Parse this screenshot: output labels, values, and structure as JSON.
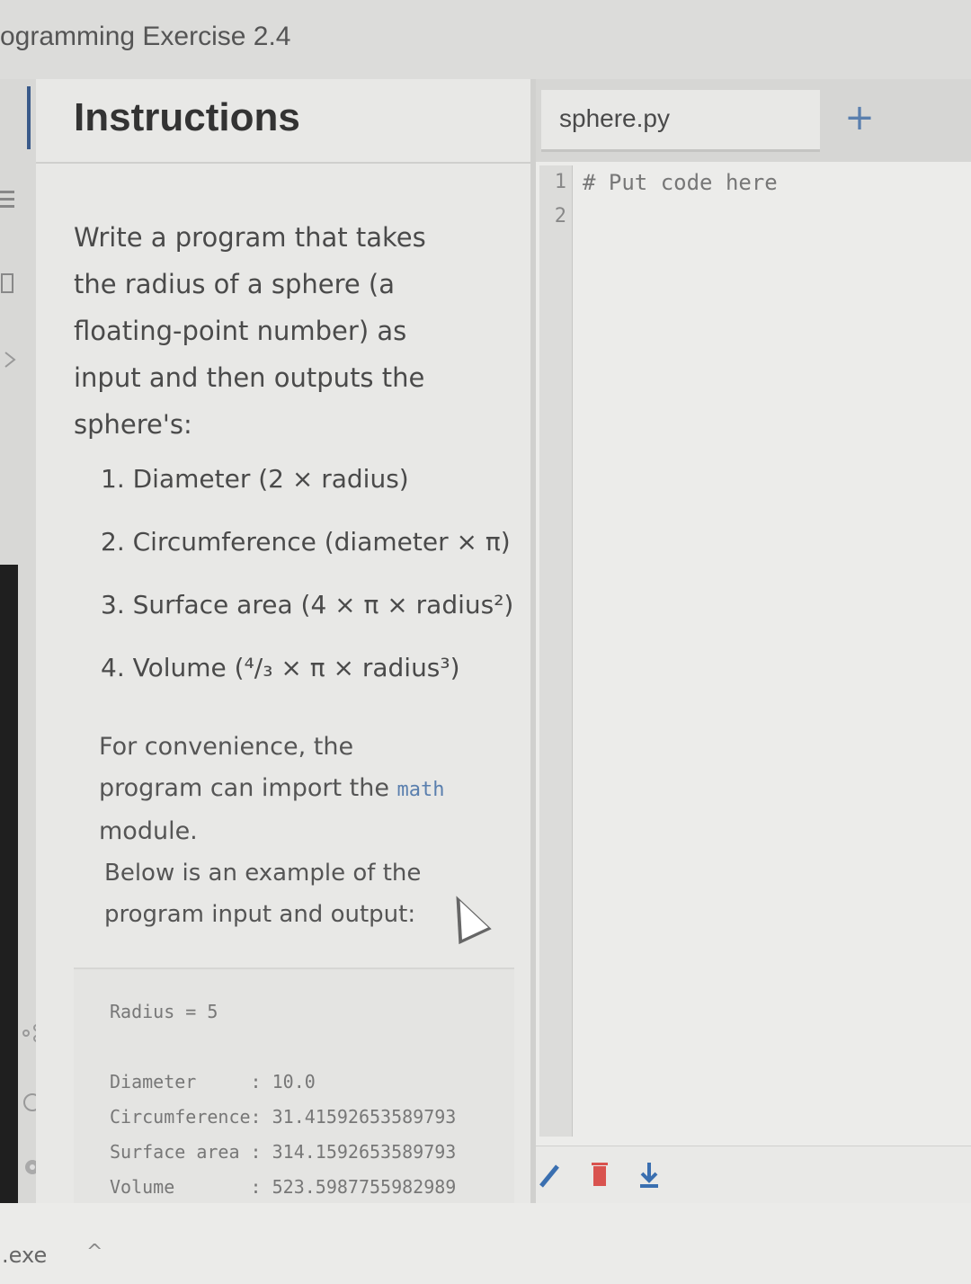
{
  "window": {
    "title": "ogramming Exercise 2.4"
  },
  "instructions": {
    "header": "Instructions",
    "paragraph1": "Write a program that takes the radius of a sphere (a floating-point number) as input and then outputs the sphere's:",
    "steps": [
      "1. Diameter (2 × radius)",
      "2. Circumference (diameter × π)",
      "3. Surface area (4 × π × radius²)",
      "4. Volume (⁴/₃ × π × radius³)"
    ],
    "para2_before": "For convenience, the program can import the ",
    "para2_code": "math",
    "para2_after": " module.",
    "paragraph3": "Below is an example of the program input and output:",
    "example": {
      "input_line": "Radius = 5",
      "outputs": [
        "Diameter     : 10.0",
        "Circumference: 31.41592653589793",
        "Surface area : 314.1592653589793",
        "Volume       : 523.5987755982989"
      ]
    }
  },
  "editor": {
    "tab_name": "sphere.py",
    "add_tab_symbol": "+",
    "line_numbers": [
      "1",
      "2"
    ],
    "lines": [
      "# Put code here",
      ""
    ]
  },
  "taskbar": {
    "exe_label": ".exe",
    "caret": "^"
  },
  "icons": {
    "editor_toolbar": [
      "pencil-icon",
      "trash-icon",
      "download-icon"
    ],
    "left_rail": [
      "list-icon",
      "book-icon",
      "code-icon",
      "share-icon",
      "help-icon",
      "settings-icon"
    ]
  },
  "colors": {
    "accent": "#3a6fb0",
    "delete": "#d9534f",
    "code_keyword": "#5a7fae"
  }
}
